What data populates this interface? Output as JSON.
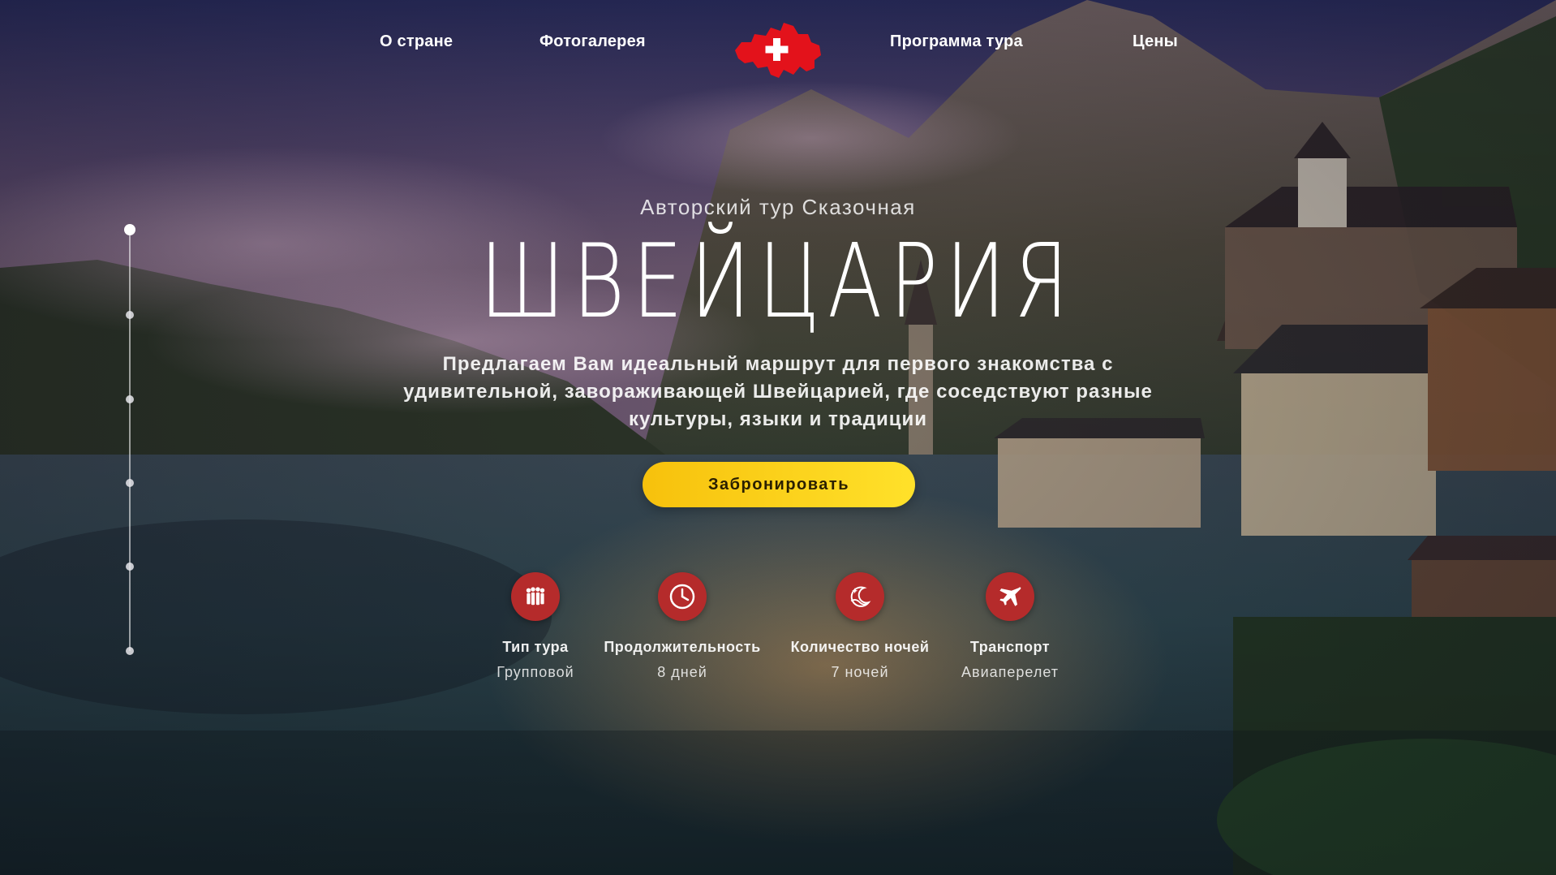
{
  "nav": {
    "items": [
      {
        "label": "О стране"
      },
      {
        "label": "Фотогалерея"
      },
      {
        "label": "Программа тура"
      },
      {
        "label": "Цены"
      }
    ],
    "logo_icon": "switzerland-flag-map-icon"
  },
  "hero": {
    "subtitle": "Авторский тур Сказочная",
    "title": "ШВЕЙЦАРИЯ",
    "description": "Предлагаем Вам идеальный маршрут для первого знакомства с удивительной, завораживающей Швейцарией, где соседствуют разные культуры, языки и традиции",
    "cta_label": "Забронировать"
  },
  "side_nav": {
    "dots": 6,
    "active_index": 0
  },
  "features": [
    {
      "icon": "group-people-icon",
      "label": "Тип тура",
      "value": "Групповой"
    },
    {
      "icon": "clock-icon",
      "label": "Продолжительность",
      "value": "8 дней"
    },
    {
      "icon": "moon-night-icon",
      "label": "Количество ночей",
      "value": "7 ночей"
    },
    {
      "icon": "airplane-icon",
      "label": "Транспорт",
      "value": "Авиаперелет"
    }
  ],
  "colors": {
    "accent_yellow": "#f7c10c",
    "icon_red": "#b52b2b",
    "logo_red": "#e3121b"
  }
}
